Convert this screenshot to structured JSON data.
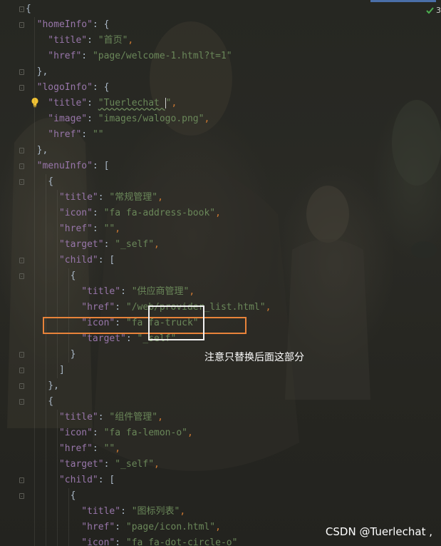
{
  "inspection": {
    "count": "3"
  },
  "lines": [
    {
      "tokens": [
        {
          "t": "{",
          "c": "b"
        }
      ]
    },
    {
      "tokens": [
        {
          "t": "  \"homeInfo\"",
          "c": "k"
        },
        {
          "t": ": {",
          "c": "b"
        }
      ]
    },
    {
      "tokens": [
        {
          "t": "    \"title\"",
          "c": "k"
        },
        {
          "t": ": ",
          "c": "b"
        },
        {
          "t": "\"首页\"",
          "c": "s"
        },
        {
          "t": ",",
          "c": "p"
        }
      ]
    },
    {
      "tokens": [
        {
          "t": "    \"href\"",
          "c": "k"
        },
        {
          "t": ": ",
          "c": "b"
        },
        {
          "t": "\"page/welcome-1.html?t=1\"",
          "c": "s"
        }
      ]
    },
    {
      "tokens": [
        {
          "t": "  },",
          "c": "b"
        }
      ]
    },
    {
      "tokens": [
        {
          "t": "  \"logoInfo\"",
          "c": "k"
        },
        {
          "t": ": {",
          "c": "b"
        }
      ]
    },
    {
      "tokens": [
        {
          "t": "    \"title\"",
          "c": "k"
        },
        {
          "t": ": ",
          "c": "b"
        },
        {
          "t": "\"Tuerlechat ",
          "c": "s",
          "typo": true
        },
        {
          "t": "CARET",
          "c": "caret"
        },
        {
          "t": "\"",
          "c": "s"
        },
        {
          "t": ",",
          "c": "p"
        }
      ]
    },
    {
      "tokens": [
        {
          "t": "    \"image\"",
          "c": "k"
        },
        {
          "t": ": ",
          "c": "b"
        },
        {
          "t": "\"images/walogo.png\"",
          "c": "s"
        },
        {
          "t": ",",
          "c": "p"
        }
      ]
    },
    {
      "tokens": [
        {
          "t": "    \"href\"",
          "c": "k"
        },
        {
          "t": ": ",
          "c": "b"
        },
        {
          "t": "\"\"",
          "c": "s"
        }
      ]
    },
    {
      "tokens": [
        {
          "t": "  },",
          "c": "b"
        }
      ]
    },
    {
      "tokens": [
        {
          "t": "  \"menuInfo\"",
          "c": "k"
        },
        {
          "t": ": [",
          "c": "b"
        }
      ]
    },
    {
      "tokens": [
        {
          "t": "    {",
          "c": "b"
        }
      ]
    },
    {
      "tokens": [
        {
          "t": "      \"title\"",
          "c": "k"
        },
        {
          "t": ": ",
          "c": "b"
        },
        {
          "t": "\"常规管理\"",
          "c": "s"
        },
        {
          "t": ",",
          "c": "p"
        }
      ]
    },
    {
      "tokens": [
        {
          "t": "      \"icon\"",
          "c": "k"
        },
        {
          "t": ": ",
          "c": "b"
        },
        {
          "t": "\"fa fa-address-book\"",
          "c": "s"
        },
        {
          "t": ",",
          "c": "p"
        }
      ]
    },
    {
      "tokens": [
        {
          "t": "      \"href\"",
          "c": "k"
        },
        {
          "t": ": ",
          "c": "b"
        },
        {
          "t": "\"\"",
          "c": "s"
        },
        {
          "t": ",",
          "c": "p"
        }
      ]
    },
    {
      "tokens": [
        {
          "t": "      \"target\"",
          "c": "k"
        },
        {
          "t": ": ",
          "c": "b"
        },
        {
          "t": "\"_self\"",
          "c": "s"
        },
        {
          "t": ",",
          "c": "p"
        }
      ]
    },
    {
      "tokens": [
        {
          "t": "      \"child\"",
          "c": "k"
        },
        {
          "t": ": [",
          "c": "b"
        }
      ]
    },
    {
      "tokens": [
        {
          "t": "        {",
          "c": "b"
        }
      ]
    },
    {
      "tokens": [
        {
          "t": "          \"title\"",
          "c": "k"
        },
        {
          "t": ": ",
          "c": "b"
        },
        {
          "t": "\"供应商管理\"",
          "c": "s"
        },
        {
          "t": ",",
          "c": "p"
        }
      ]
    },
    {
      "tokens": [
        {
          "t": "          \"href\"",
          "c": "k"
        },
        {
          "t": ": ",
          "c": "b"
        },
        {
          "t": "\"/web/provider_list.html\"",
          "c": "s"
        },
        {
          "t": ",",
          "c": "p"
        }
      ]
    },
    {
      "tokens": [
        {
          "t": "          \"icon\"",
          "c": "k"
        },
        {
          "t": ": ",
          "c": "b"
        },
        {
          "t": "\"fa fa-truck\"",
          "c": "s"
        }
      ]
    },
    {
      "tokens": [
        {
          "t": "          \"target\"",
          "c": "k"
        },
        {
          "t": ": ",
          "c": "b"
        },
        {
          "t": "\"_self\"",
          "c": "s"
        }
      ]
    },
    {
      "tokens": [
        {
          "t": "        }",
          "c": "b"
        }
      ]
    },
    {
      "tokens": [
        {
          "t": "      ]",
          "c": "b"
        }
      ]
    },
    {
      "tokens": [
        {
          "t": "    },",
          "c": "b"
        }
      ]
    },
    {
      "tokens": [
        {
          "t": "    {",
          "c": "b"
        }
      ]
    },
    {
      "tokens": [
        {
          "t": "      \"title\"",
          "c": "k"
        },
        {
          "t": ": ",
          "c": "b"
        },
        {
          "t": "\"组件管理\"",
          "c": "s"
        },
        {
          "t": ",",
          "c": "p"
        }
      ]
    },
    {
      "tokens": [
        {
          "t": "      \"icon\"",
          "c": "k"
        },
        {
          "t": ": ",
          "c": "b"
        },
        {
          "t": "\"fa fa-lemon-o\"",
          "c": "s"
        },
        {
          "t": ",",
          "c": "p"
        }
      ]
    },
    {
      "tokens": [
        {
          "t": "      \"href\"",
          "c": "k"
        },
        {
          "t": ": ",
          "c": "b"
        },
        {
          "t": "\"\"",
          "c": "s"
        },
        {
          "t": ",",
          "c": "p"
        }
      ]
    },
    {
      "tokens": [
        {
          "t": "      \"target\"",
          "c": "k"
        },
        {
          "t": ": ",
          "c": "b"
        },
        {
          "t": "\"_self\"",
          "c": "s"
        },
        {
          "t": ",",
          "c": "p"
        }
      ]
    },
    {
      "tokens": [
        {
          "t": "      \"child\"",
          "c": "k"
        },
        {
          "t": ": [",
          "c": "b"
        }
      ]
    },
    {
      "tokens": [
        {
          "t": "        {",
          "c": "b"
        }
      ]
    },
    {
      "tokens": [
        {
          "t": "          \"title\"",
          "c": "k"
        },
        {
          "t": ": ",
          "c": "b"
        },
        {
          "t": "\"图标列表\"",
          "c": "s"
        },
        {
          "t": ",",
          "c": "p"
        }
      ]
    },
    {
      "tokens": [
        {
          "t": "          \"href\"",
          "c": "k"
        },
        {
          "t": ": ",
          "c": "b"
        },
        {
          "t": "\"page/icon.html\"",
          "c": "s"
        },
        {
          "t": ",",
          "c": "p"
        }
      ]
    },
    {
      "tokens": [
        {
          "t": "          \"icon\"",
          "c": "k"
        },
        {
          "t": ": ",
          "c": "b"
        },
        {
          "t": "\"fa fa-dot-circle-o\"",
          "c": "s"
        }
      ]
    }
  ],
  "annotation": {
    "note": "注意只替换后面这部分"
  },
  "watermark": {
    "text": "CSDN @Tuerlechat ,"
  },
  "colors": {
    "key": "#9876aa",
    "string": "#6a8759",
    "punctuation": "#cc7832",
    "brace": "#a9b7c6",
    "highlight_orange": "#e8833a",
    "highlight_white": "#f2f2f2"
  },
  "icons": {
    "bulb": "lightbulb-icon",
    "inspection": "check-icon"
  }
}
